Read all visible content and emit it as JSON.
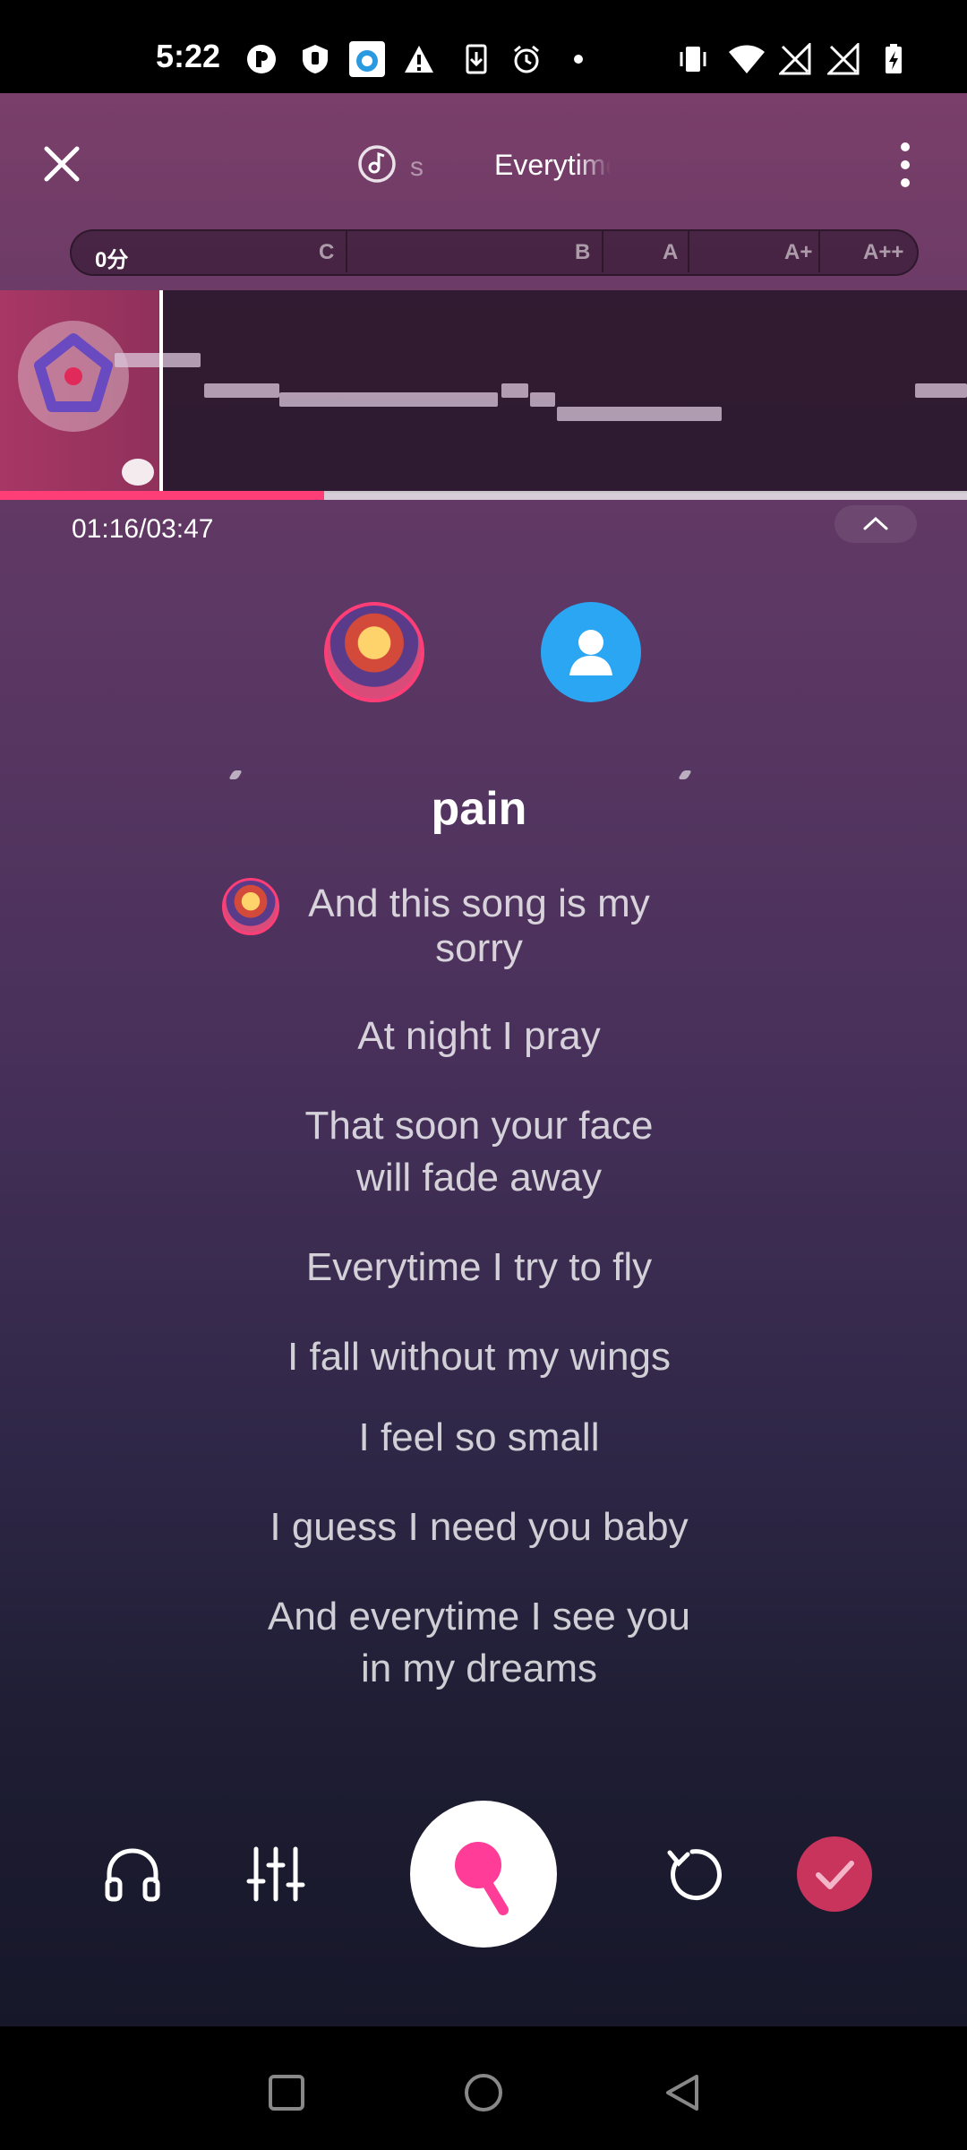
{
  "status_bar": {
    "time": "5:22"
  },
  "header": {
    "song_prefix": "s",
    "song_title": "Everytime"
  },
  "score_bar": {
    "current_score": "0分",
    "grades": [
      "C",
      "B",
      "A",
      "A+",
      "A++"
    ]
  },
  "playback": {
    "time": "01:16/03:47",
    "progress": 0.335
  },
  "lyrics": {
    "current": "pain",
    "lines": [
      "And this song is my",
      "sorry",
      "At night I pray",
      "That soon your face",
      "will fade away",
      "Everytime I try to fly",
      "I fall without my wings",
      "I feel so small",
      "I guess I need you baby",
      "And everytime I see you",
      "in my dreams"
    ]
  },
  "colors": {
    "accent": "#ff3d77",
    "avatar_blue": "#2ba6f2",
    "done": "#c9345d"
  }
}
